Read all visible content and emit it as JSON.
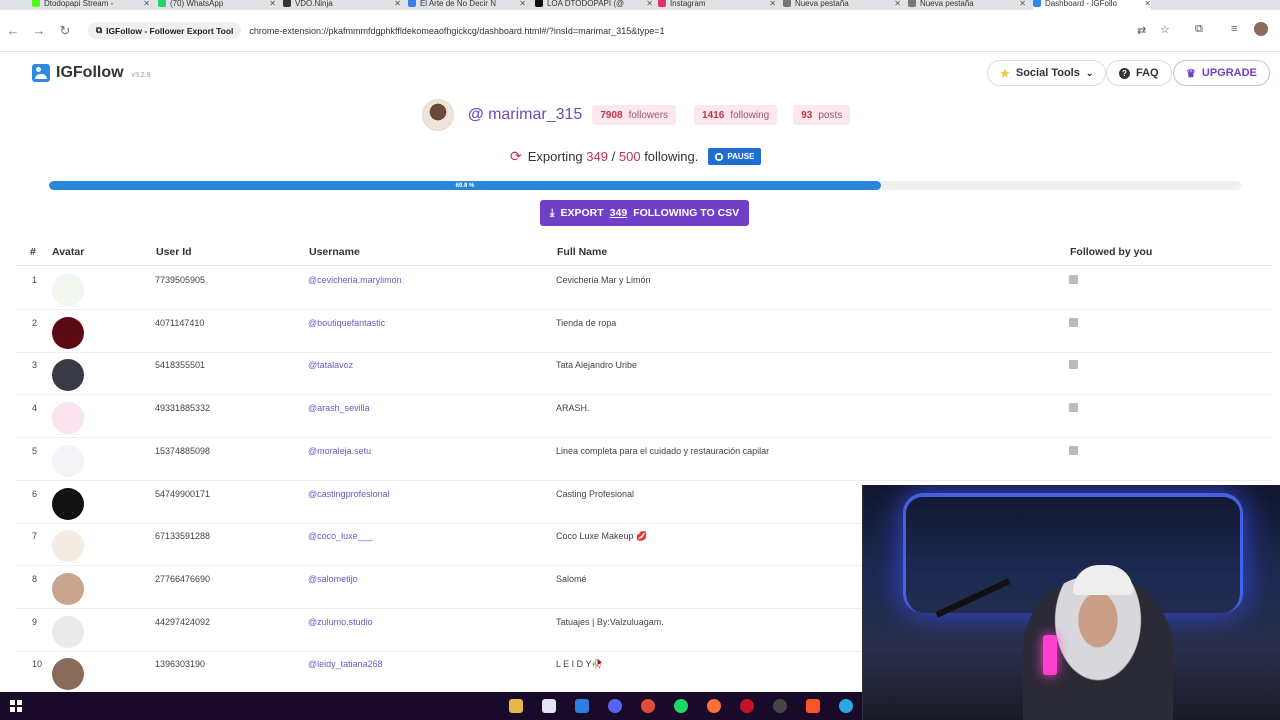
{
  "browser": {
    "tabs": [
      {
        "label": "Dtodopapi Stream -",
        "color": "#53fc18"
      },
      {
        "label": "(70) WhatsApp",
        "color": "#25d366"
      },
      {
        "label": "VDO.Ninja",
        "color": "#333333"
      },
      {
        "label": "El Arte de No Decir N",
        "color": "#3b7de0"
      },
      {
        "label": "LOA DTODOPAPI (@",
        "color": "#111111"
      },
      {
        "label": "Instagram",
        "color": "#e1306c"
      },
      {
        "label": "Nueva pestaña",
        "color": "#777777"
      },
      {
        "label": "Nueva pestaña",
        "color": "#777777"
      },
      {
        "label": "Dashboard - IGFollo",
        "color": "#2c8be0"
      }
    ],
    "url_chip": "IGFollow - Follower Export Tool",
    "url": "chrome-extension://pkafmmmfdgphkffldekomeaofhgickcg/dashboard.html#/?insId=marimar_315&type=1"
  },
  "header": {
    "logo_text": "IGFollow",
    "version": "v3.2.9",
    "social_tools": "Social Tools",
    "faq": "FAQ",
    "upgrade": "UPGRADE"
  },
  "profile": {
    "username": "marimar_315",
    "followers_count": "7908",
    "followers_label": "followers",
    "following_count": "1416",
    "following_label": "following",
    "posts_count": "93",
    "posts_label": "posts"
  },
  "export": {
    "prefix": "Exporting",
    "done": "349",
    "sep": "/",
    "total": "500",
    "suffix": "following.",
    "pause": "PAUSE",
    "progress_text": "69.8 %",
    "progress_value": 69.8,
    "button_pre": "EXPORT",
    "button_count": "349",
    "button_post": "FOLLOWING TO CSV"
  },
  "table": {
    "headers": {
      "num": "#",
      "avatar": "Avatar",
      "user_id": "User Id",
      "username": "Username",
      "full_name": "Full Name",
      "followed": "Followed by you"
    },
    "rows": [
      {
        "num": "1",
        "id": "7739505905",
        "user": "@cevicheria.marylimon",
        "full": "Cevicheria Mar y Limón",
        "checked": true,
        "avatar": "#f2f7f0"
      },
      {
        "num": "2",
        "id": "4071147410",
        "user": "@boutiquefantastic",
        "full": "Tienda de ropa",
        "checked": true,
        "avatar": "#5a0a12"
      },
      {
        "num": "3",
        "id": "5418355501",
        "user": "@tatalavoz",
        "full": "Tata Alejandro Uribe",
        "checked": true,
        "avatar": "#3a3a44"
      },
      {
        "num": "4",
        "id": "49331885332",
        "user": "@arash_sevilla",
        "full": "ARASH.",
        "checked": true,
        "avatar": "#fbe3ef"
      },
      {
        "num": "5",
        "id": "15374885098",
        "user": "@moraleja.setu",
        "full": "Linea completa para el cuidado y restauración capilar",
        "checked": true,
        "avatar": "#f3f3f8"
      },
      {
        "num": "6",
        "id": "54749900171",
        "user": "@castingprofesional",
        "full": "Casting Profesional",
        "checked": false,
        "avatar": "#111111"
      },
      {
        "num": "7",
        "id": "67133591288",
        "user": "@coco_luxe___",
        "full": "Coco Luxe Makeup 💋",
        "checked": false,
        "avatar": "#f4ece2"
      },
      {
        "num": "8",
        "id": "27766476690",
        "user": "@salometijo",
        "full": "Salomé",
        "checked": false,
        "avatar": "#c9a58f"
      },
      {
        "num": "9",
        "id": "44297424092",
        "user": "@zulumo.studio",
        "full": "Tatuajes | By:Valzuluagam.",
        "checked": false,
        "avatar": "#eaeaea"
      },
      {
        "num": "10",
        "id": "1396303190",
        "user": "@leidy_tatiana268",
        "full": "L E I D Y🥀",
        "checked": false,
        "avatar": "#8a6a5a"
      }
    ]
  }
}
